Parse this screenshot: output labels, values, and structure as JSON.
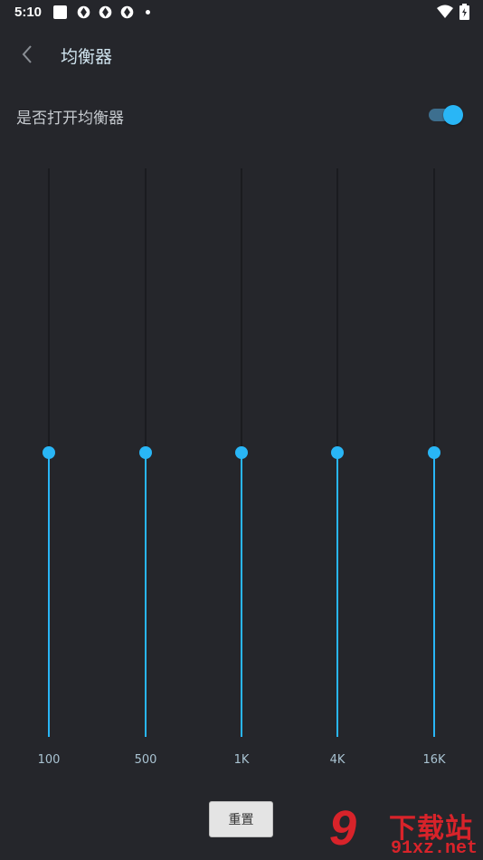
{
  "status_bar": {
    "time": "5:10"
  },
  "app_bar": {
    "title": "均衡器"
  },
  "equalizer_toggle": {
    "label": "是否打开均衡器",
    "enabled": true
  },
  "equalizer": {
    "bands": [
      {
        "label": "100",
        "level": 0.5
      },
      {
        "label": "500",
        "level": 0.5
      },
      {
        "label": "1K",
        "level": 0.5
      },
      {
        "label": "4K",
        "level": 0.5
      },
      {
        "label": "16K",
        "level": 0.5
      }
    ]
  },
  "reset_button": {
    "label": "重置"
  },
  "watermark": {
    "logo_text": "9",
    "site_name": "下载站",
    "url": "91xz.net"
  },
  "colors": {
    "background": "#25262b",
    "accent": "#29b6f6",
    "watermark": "#d8232a"
  }
}
